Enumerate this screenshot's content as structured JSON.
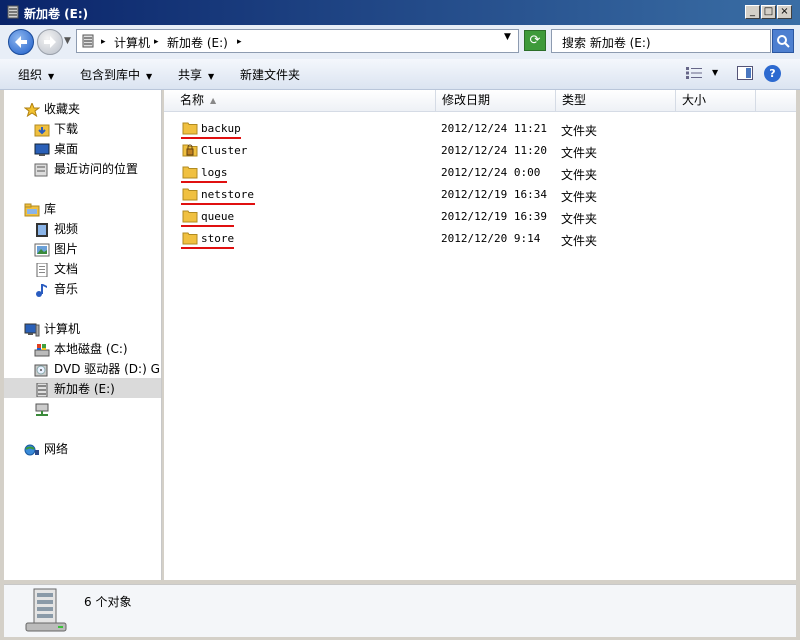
{
  "window": {
    "title": "新加卷 (E:)"
  },
  "address": {
    "crumbs": [
      "计算机",
      "新加卷 (E:)"
    ],
    "search_placeholder": "搜索 新加卷 (E:)"
  },
  "toolbar": {
    "organize": "组织",
    "include_in_library": "包含到库中",
    "share": "共享",
    "new_folder": "新建文件夹"
  },
  "nav": {
    "favorites": "收藏夹",
    "downloads": "下载",
    "desktop": "桌面",
    "recent": "最近访问的位置",
    "libraries": "库",
    "videos": "视频",
    "pictures": "图片",
    "documents": "文档",
    "music": "音乐",
    "computer": "计算机",
    "local_disk": "本地磁盘 (C:)",
    "dvd_drive": "DVD 驱动器 (D:) GF",
    "new_volume": "新加卷 (E:)",
    "network": "网络"
  },
  "columns": {
    "name": "名称",
    "modified": "修改日期",
    "type": "类型",
    "size": "大小"
  },
  "files": [
    {
      "name": "backup",
      "modified": "2012/12/24 11:21",
      "type": "文件夹",
      "locked": false,
      "underlined": true
    },
    {
      "name": "Cluster",
      "modified": "2012/12/24 11:20",
      "type": "文件夹",
      "locked": true,
      "underlined": false
    },
    {
      "name": "logs",
      "modified": "2012/12/24 0:00",
      "type": "文件夹",
      "locked": false,
      "underlined": true
    },
    {
      "name": "netstore",
      "modified": "2012/12/19 16:34",
      "type": "文件夹",
      "locked": false,
      "underlined": true
    },
    {
      "name": "queue",
      "modified": "2012/12/19 16:39",
      "type": "文件夹",
      "locked": false,
      "underlined": true
    },
    {
      "name": "store",
      "modified": "2012/12/20 9:14",
      "type": "文件夹",
      "locked": false,
      "underlined": true
    }
  ],
  "status": {
    "count_text": "6 个对象"
  },
  "colors": {
    "title_bar": "#0a246a",
    "underline": "#e01010",
    "folder": "#f0c040"
  }
}
